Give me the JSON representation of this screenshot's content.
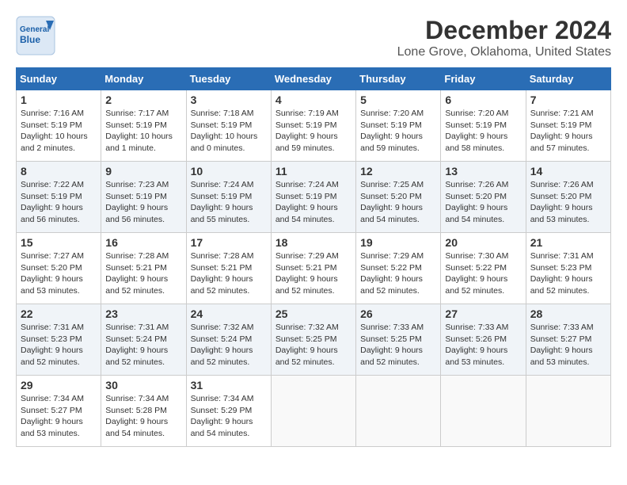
{
  "header": {
    "logo_line1": "General",
    "logo_line2": "Blue",
    "month": "December 2024",
    "location": "Lone Grove, Oklahoma, United States"
  },
  "days_of_week": [
    "Sunday",
    "Monday",
    "Tuesday",
    "Wednesday",
    "Thursday",
    "Friday",
    "Saturday"
  ],
  "weeks": [
    [
      {
        "day": "1",
        "sunrise": "7:16 AM",
        "sunset": "5:19 PM",
        "daylight": "10 hours and 2 minutes."
      },
      {
        "day": "2",
        "sunrise": "7:17 AM",
        "sunset": "5:19 PM",
        "daylight": "10 hours and 1 minute."
      },
      {
        "day": "3",
        "sunrise": "7:18 AM",
        "sunset": "5:19 PM",
        "daylight": "10 hours and 0 minutes."
      },
      {
        "day": "4",
        "sunrise": "7:19 AM",
        "sunset": "5:19 PM",
        "daylight": "9 hours and 59 minutes."
      },
      {
        "day": "5",
        "sunrise": "7:20 AM",
        "sunset": "5:19 PM",
        "daylight": "9 hours and 59 minutes."
      },
      {
        "day": "6",
        "sunrise": "7:20 AM",
        "sunset": "5:19 PM",
        "daylight": "9 hours and 58 minutes."
      },
      {
        "day": "7",
        "sunrise": "7:21 AM",
        "sunset": "5:19 PM",
        "daylight": "9 hours and 57 minutes."
      }
    ],
    [
      {
        "day": "8",
        "sunrise": "7:22 AM",
        "sunset": "5:19 PM",
        "daylight": "9 hours and 56 minutes."
      },
      {
        "day": "9",
        "sunrise": "7:23 AM",
        "sunset": "5:19 PM",
        "daylight": "9 hours and 56 minutes."
      },
      {
        "day": "10",
        "sunrise": "7:24 AM",
        "sunset": "5:19 PM",
        "daylight": "9 hours and 55 minutes."
      },
      {
        "day": "11",
        "sunrise": "7:24 AM",
        "sunset": "5:19 PM",
        "daylight": "9 hours and 54 minutes."
      },
      {
        "day": "12",
        "sunrise": "7:25 AM",
        "sunset": "5:20 PM",
        "daylight": "9 hours and 54 minutes."
      },
      {
        "day": "13",
        "sunrise": "7:26 AM",
        "sunset": "5:20 PM",
        "daylight": "9 hours and 54 minutes."
      },
      {
        "day": "14",
        "sunrise": "7:26 AM",
        "sunset": "5:20 PM",
        "daylight": "9 hours and 53 minutes."
      }
    ],
    [
      {
        "day": "15",
        "sunrise": "7:27 AM",
        "sunset": "5:20 PM",
        "daylight": "9 hours and 53 minutes."
      },
      {
        "day": "16",
        "sunrise": "7:28 AM",
        "sunset": "5:21 PM",
        "daylight": "9 hours and 52 minutes."
      },
      {
        "day": "17",
        "sunrise": "7:28 AM",
        "sunset": "5:21 PM",
        "daylight": "9 hours and 52 minutes."
      },
      {
        "day": "18",
        "sunrise": "7:29 AM",
        "sunset": "5:21 PM",
        "daylight": "9 hours and 52 minutes."
      },
      {
        "day": "19",
        "sunrise": "7:29 AM",
        "sunset": "5:22 PM",
        "daylight": "9 hours and 52 minutes."
      },
      {
        "day": "20",
        "sunrise": "7:30 AM",
        "sunset": "5:22 PM",
        "daylight": "9 hours and 52 minutes."
      },
      {
        "day": "21",
        "sunrise": "7:31 AM",
        "sunset": "5:23 PM",
        "daylight": "9 hours and 52 minutes."
      }
    ],
    [
      {
        "day": "22",
        "sunrise": "7:31 AM",
        "sunset": "5:23 PM",
        "daylight": "9 hours and 52 minutes."
      },
      {
        "day": "23",
        "sunrise": "7:31 AM",
        "sunset": "5:24 PM",
        "daylight": "9 hours and 52 minutes."
      },
      {
        "day": "24",
        "sunrise": "7:32 AM",
        "sunset": "5:24 PM",
        "daylight": "9 hours and 52 minutes."
      },
      {
        "day": "25",
        "sunrise": "7:32 AM",
        "sunset": "5:25 PM",
        "daylight": "9 hours and 52 minutes."
      },
      {
        "day": "26",
        "sunrise": "7:33 AM",
        "sunset": "5:25 PM",
        "daylight": "9 hours and 52 minutes."
      },
      {
        "day": "27",
        "sunrise": "7:33 AM",
        "sunset": "5:26 PM",
        "daylight": "9 hours and 53 minutes."
      },
      {
        "day": "28",
        "sunrise": "7:33 AM",
        "sunset": "5:27 PM",
        "daylight": "9 hours and 53 minutes."
      }
    ],
    [
      {
        "day": "29",
        "sunrise": "7:34 AM",
        "sunset": "5:27 PM",
        "daylight": "9 hours and 53 minutes."
      },
      {
        "day": "30",
        "sunrise": "7:34 AM",
        "sunset": "5:28 PM",
        "daylight": "9 hours and 54 minutes."
      },
      {
        "day": "31",
        "sunrise": "7:34 AM",
        "sunset": "5:29 PM",
        "daylight": "9 hours and 54 minutes."
      },
      null,
      null,
      null,
      null
    ]
  ],
  "labels": {
    "sunrise": "Sunrise:",
    "sunset": "Sunset:",
    "daylight": "Daylight:"
  }
}
